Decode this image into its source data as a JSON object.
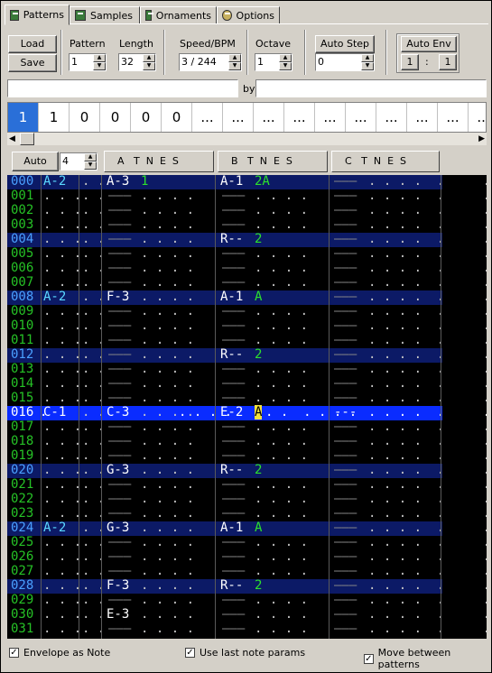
{
  "tabs": [
    {
      "label": "Patterns",
      "icon": "patterns-icon",
      "active": true
    },
    {
      "label": "Samples",
      "icon": "samples-icon"
    },
    {
      "label": "Ornaments",
      "icon": "ornaments-icon"
    },
    {
      "label": "Options",
      "icon": "options-gear-icon"
    }
  ],
  "toolbar": {
    "load_label": "Load",
    "save_label": "Save",
    "pattern_label": "Pattern",
    "pattern_value": "1",
    "length_label": "Length",
    "length_value": "32",
    "speed_label": "Speed/BPM",
    "speed_value": "3 / 244",
    "octave_label": "Octave",
    "octave_value": "1",
    "autostep_label": "Auto Step",
    "autostep_value": "0",
    "autoenv_label": "Auto Env",
    "autoenv_a": "1",
    "autoenv_sep": ":",
    "autoenv_b": "1"
  },
  "by_label": "by",
  "positions": [
    "1",
    "1",
    "0",
    "0",
    "0",
    "0",
    "...",
    "...",
    "...",
    "...",
    "...",
    "...",
    "...",
    "...",
    "...",
    "..."
  ],
  "channel_header": {
    "auto_label": "Auto",
    "auto_value": "4",
    "a": "A   T  N  E  S",
    "b": "B   T  N  E  S",
    "c": "C   T  N  E  S"
  },
  "rows": [
    {
      "n": "000",
      "env": "A-2",
      "a": "A-3",
      "at": "1",
      "b": "A-1",
      "bt": "2A"
    },
    {
      "n": "001"
    },
    {
      "n": "002"
    },
    {
      "n": "003"
    },
    {
      "n": "004",
      "b": "R--",
      "bt": "2"
    },
    {
      "n": "005"
    },
    {
      "n": "006"
    },
    {
      "n": "007"
    },
    {
      "n": "008",
      "env": "A-2",
      "a": "F-3",
      "b": "A-1",
      "bt": "A"
    },
    {
      "n": "009"
    },
    {
      "n": "010"
    },
    {
      "n": "011"
    },
    {
      "n": "012",
      "b": "R--",
      "bt": "2"
    },
    {
      "n": "013"
    },
    {
      "n": "014"
    },
    {
      "n": "015"
    },
    {
      "n": "016",
      "env": "C-1",
      "a": "C-3",
      "b": "E-2",
      "bt": "A"
    },
    {
      "n": "017"
    },
    {
      "n": "018"
    },
    {
      "n": "019"
    },
    {
      "n": "020",
      "a": "G-3",
      "b": "R--",
      "bt": "2"
    },
    {
      "n": "021"
    },
    {
      "n": "022"
    },
    {
      "n": "023"
    },
    {
      "n": "024",
      "env": "A-2",
      "a": "G-3",
      "b": "A-1",
      "bt": "A"
    },
    {
      "n": "025"
    },
    {
      "n": "026"
    },
    {
      "n": "027"
    },
    {
      "n": "028",
      "a": "F-3",
      "b": "R--",
      "bt": "2"
    },
    {
      "n": "029"
    },
    {
      "n": "030",
      "a": "E-3"
    },
    {
      "n": "031"
    }
  ],
  "options": {
    "envelope_as_note": "Envelope as Note",
    "use_last_note_params": "Use last note params",
    "move_between_patterns": "Move between patterns"
  },
  "colors": {
    "grid_bg": "#000000",
    "highlight_row": "#0c1a66",
    "cursor_row": "#0a2cff",
    "row_num": "#26c226",
    "envelope": "#5ad8ff",
    "param": "#2ce02c"
  }
}
